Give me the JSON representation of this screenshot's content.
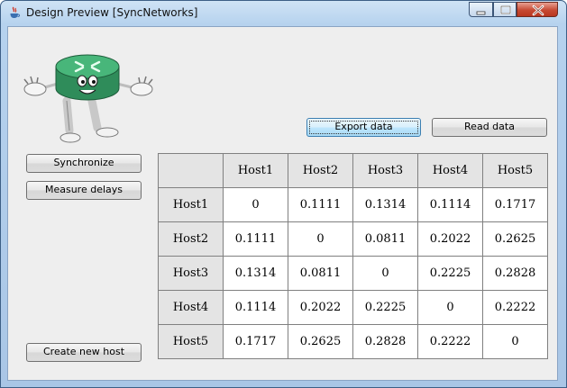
{
  "window": {
    "title": "Design Preview [SyncNetworks]"
  },
  "buttons": {
    "export": "Export data",
    "read": "Read data",
    "synchronize": "Synchronize",
    "measure": "Measure delays",
    "create_host": "Create new host"
  },
  "table": {
    "columns": [
      "Host1",
      "Host2",
      "Host3",
      "Host4",
      "Host5"
    ],
    "rows": [
      {
        "name": "Host1",
        "values": [
          "0",
          "0.1111",
          "0.1314",
          "0.1114",
          "0.1717"
        ]
      },
      {
        "name": "Host2",
        "values": [
          "0.1111",
          "0",
          "0.0811",
          "0.2022",
          "0.2625"
        ]
      },
      {
        "name": "Host3",
        "values": [
          "0.1314",
          "0.0811",
          "0",
          "0.2225",
          "0.2828"
        ]
      },
      {
        "name": "Host4",
        "values": [
          "0.1114",
          "0.2022",
          "0.2225",
          "0",
          "0.2222"
        ]
      },
      {
        "name": "Host5",
        "values": [
          "0.1717",
          "0.2625",
          "0.2828",
          "0.2222",
          "0"
        ]
      }
    ]
  },
  "icons": {
    "app": "java-app-icon",
    "mascot": "router-mascot-icon"
  }
}
